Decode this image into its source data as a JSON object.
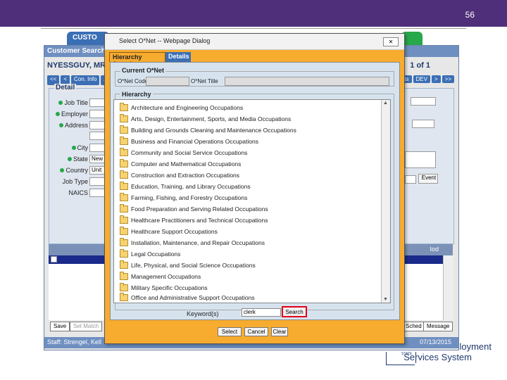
{
  "slide": {
    "number": "56"
  },
  "app": {
    "tabs": [
      {
        "label": "CUSTO",
        "color": "#3b6fb5"
      },
      {
        "label": "",
        "color": "#27a84a"
      }
    ],
    "title": "Customer Search",
    "customer_name": "NYESSGUY, MR",
    "page": "1 of 1",
    "nav_left": [
      "<<",
      "<",
      "Con. Info",
      "A"
    ],
    "nav_right": [
      "nts",
      "DEV",
      ">",
      ">>"
    ],
    "detail_title": "Detail",
    "fields": [
      {
        "label": "Job Title",
        "dot": true,
        "value": ""
      },
      {
        "label": "Employer",
        "dot": true,
        "value": ""
      },
      {
        "label": "Address",
        "dot": true,
        "value": ""
      },
      {
        "label": "City",
        "dot": true,
        "value": ""
      },
      {
        "label": "State",
        "dot": true,
        "value": "New"
      },
      {
        "label": "Country",
        "dot": true,
        "value": "Unit"
      },
      {
        "label": "Job Type",
        "dot": false,
        "value": ""
      },
      {
        "label": "NAICS",
        "dot": false,
        "value": ""
      }
    ],
    "ext_label": "xt",
    "event_button": "Event",
    "grid_col": "Iod",
    "bottom_left": [
      "Save",
      "Set Match"
    ],
    "bottom_right": [
      "Sched",
      "Message"
    ],
    "status_left": "Staff: Strengel, Kell",
    "status_date": "07/13/2015"
  },
  "dialog": {
    "title": "Select O*Net -- Webpage Dialog",
    "close": "✕",
    "tabs": {
      "hierarchy": "Hierarchy Search",
      "details": "Details"
    },
    "current_onet": {
      "legend": "Current O*Net",
      "code_label": "O*Net Code",
      "title_label": "O*Net Title"
    },
    "hierarchy": {
      "legend": "Hierarchy",
      "items": [
        "Architecture and Engineering Occupations",
        "Arts, Design, Entertainment, Sports, and Media Occupations",
        "Building and Grounds Cleaning and Maintenance Occupations",
        "Business and Financial Operations Occupations",
        "Community and Social Service Occupations",
        "Computer and Mathematical Occupations",
        "Construction and Extraction Occupations",
        "Education, Training, and Library Occupations",
        "Farming, Fishing, and Forestry Occupations",
        "Food Preparation and Serving Related Occupations",
        "Healthcare Practitioners and Technical Occupations",
        "Healthcare Support Occupations",
        "Installation, Maintenance, and Repair Occupations",
        "Legal Occupations",
        "Life, Physical, and Social Science Occupations",
        "Management Occupations",
        "Military Specific Occupations",
        "Office and Administrative Support Occupations"
      ]
    },
    "keyword": {
      "label": "Keyword(s)",
      "value": "clerk"
    },
    "search_button": "Search",
    "buttons": {
      "select": "Select",
      "cancel": "Cancel",
      "clear": "Clear"
    }
  },
  "logo": {
    "line1": "loyment",
    "line2": "Services System",
    "small": "STATE"
  }
}
